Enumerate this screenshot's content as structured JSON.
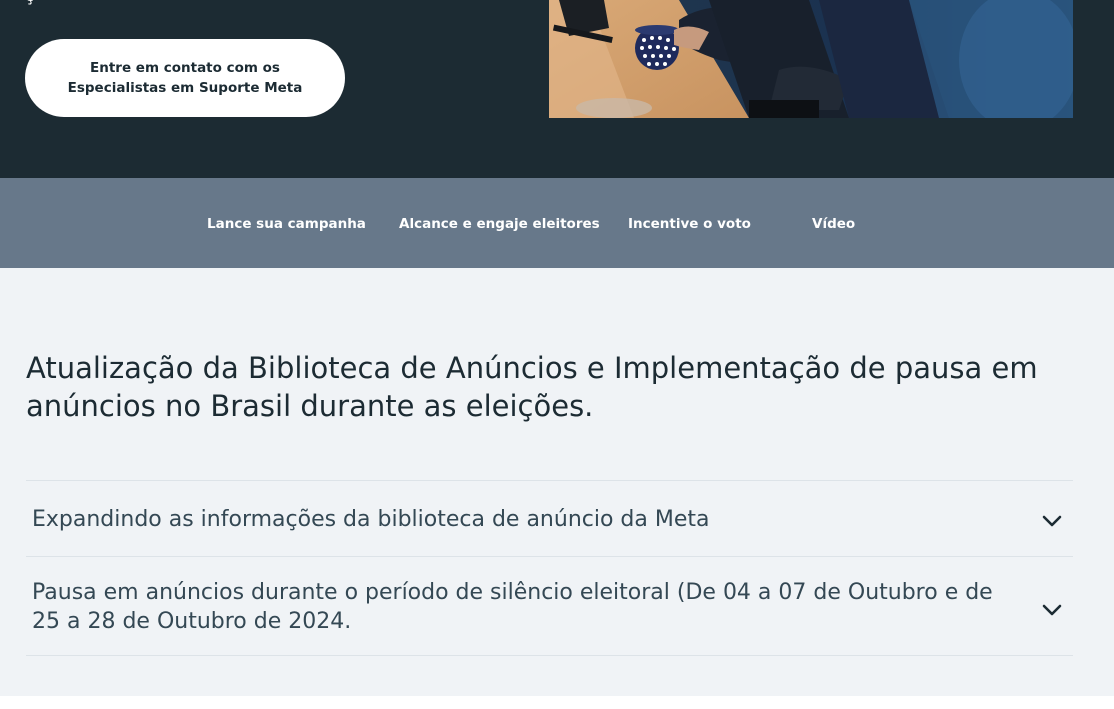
{
  "hero": {
    "partial_text": "ç",
    "cta_line1": "Entre em contato com os",
    "cta_line2": "Especialistas em Suporte Meta",
    "background_color": "#1c2b33",
    "photo_icon": "office-meeting-photo"
  },
  "tabs": [
    {
      "label": "Lance sua campanha"
    },
    {
      "label": "Alcance e engaje eleitores"
    },
    {
      "label": "Incentive o voto"
    },
    {
      "label": "Vídeo"
    }
  ],
  "section": {
    "title": "Atualização da Biblioteca de Anúncios e Implementação de pausa em anúncios no Brasil durante as eleições."
  },
  "accordion": [
    {
      "label": "Expandindo as informações da biblioteca de anúncio da Meta",
      "icon": "chevron-down-icon"
    },
    {
      "label": "Pausa em anúncios durante o período de silêncio eleitoral (De 04 a 07 de Outubro e de 25 a 28 de Outubro de 2024.",
      "icon": "chevron-down-icon"
    }
  ],
  "colors": {
    "tab_bar": "#67788a",
    "content_bg": "#f0f3f6",
    "text_dark": "#1c2b33"
  }
}
